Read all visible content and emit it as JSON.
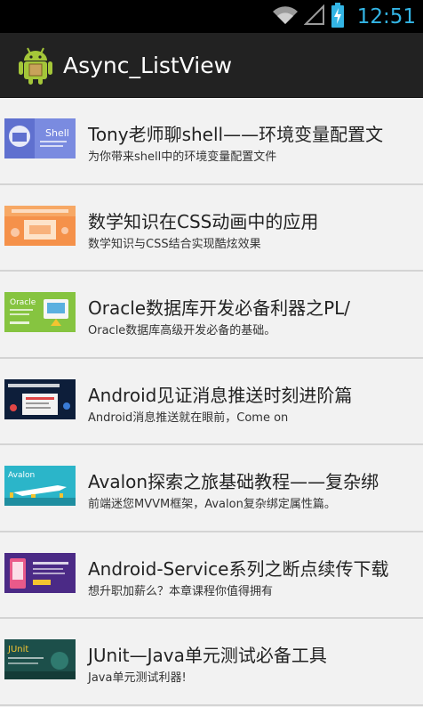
{
  "status_bar": {
    "time": "12:51",
    "icons": [
      "wifi-icon",
      "signal-icon",
      "battery-charging-icon"
    ],
    "accent": "#33b5e5"
  },
  "action_bar": {
    "title": "Async_ListView",
    "icon": "android-robot-icon"
  },
  "list": {
    "items": [
      {
        "title": "Tony老师聊shell——环境变量配置文",
        "subtitle": "为你带来shell中的环境变量配置文件",
        "thumb_text": "Shell",
        "thumb_color": "#7a8be0"
      },
      {
        "title": "数学知识在CSS动画中的应用",
        "subtitle": "数学知识与CSS结合实现酷炫效果",
        "thumb_text": "",
        "thumb_color": "#f5914a"
      },
      {
        "title": "Oracle数据库开发必备利器之PL/",
        "subtitle": "Oracle数据库高级开发必备的基础。",
        "thumb_text": "Oracle",
        "thumb_color": "#86c440"
      },
      {
        "title": "Android见证消息推送时刻进阶篇",
        "subtitle": "Android消息推送就在眼前，Come on",
        "thumb_text": "",
        "thumb_color": "#0d1e3a"
      },
      {
        "title": "Avalon探索之旅基础教程——复杂绑",
        "subtitle": "前端迷您MVVM框架，Avalon复杂绑定属性篇。",
        "thumb_text": "Avalon",
        "thumb_color": "#2bb5c9"
      },
      {
        "title": "Android-Service系列之断点续传下载",
        "subtitle": "想升职加薪么？本章课程你值得拥有",
        "thumb_text": "",
        "thumb_color": "#4b2a86"
      },
      {
        "title": "JUnit—Java单元测试必备工具",
        "subtitle": "Java单元测试利器!",
        "thumb_text": "JUnit",
        "thumb_color": "#1c4f4a"
      }
    ]
  }
}
